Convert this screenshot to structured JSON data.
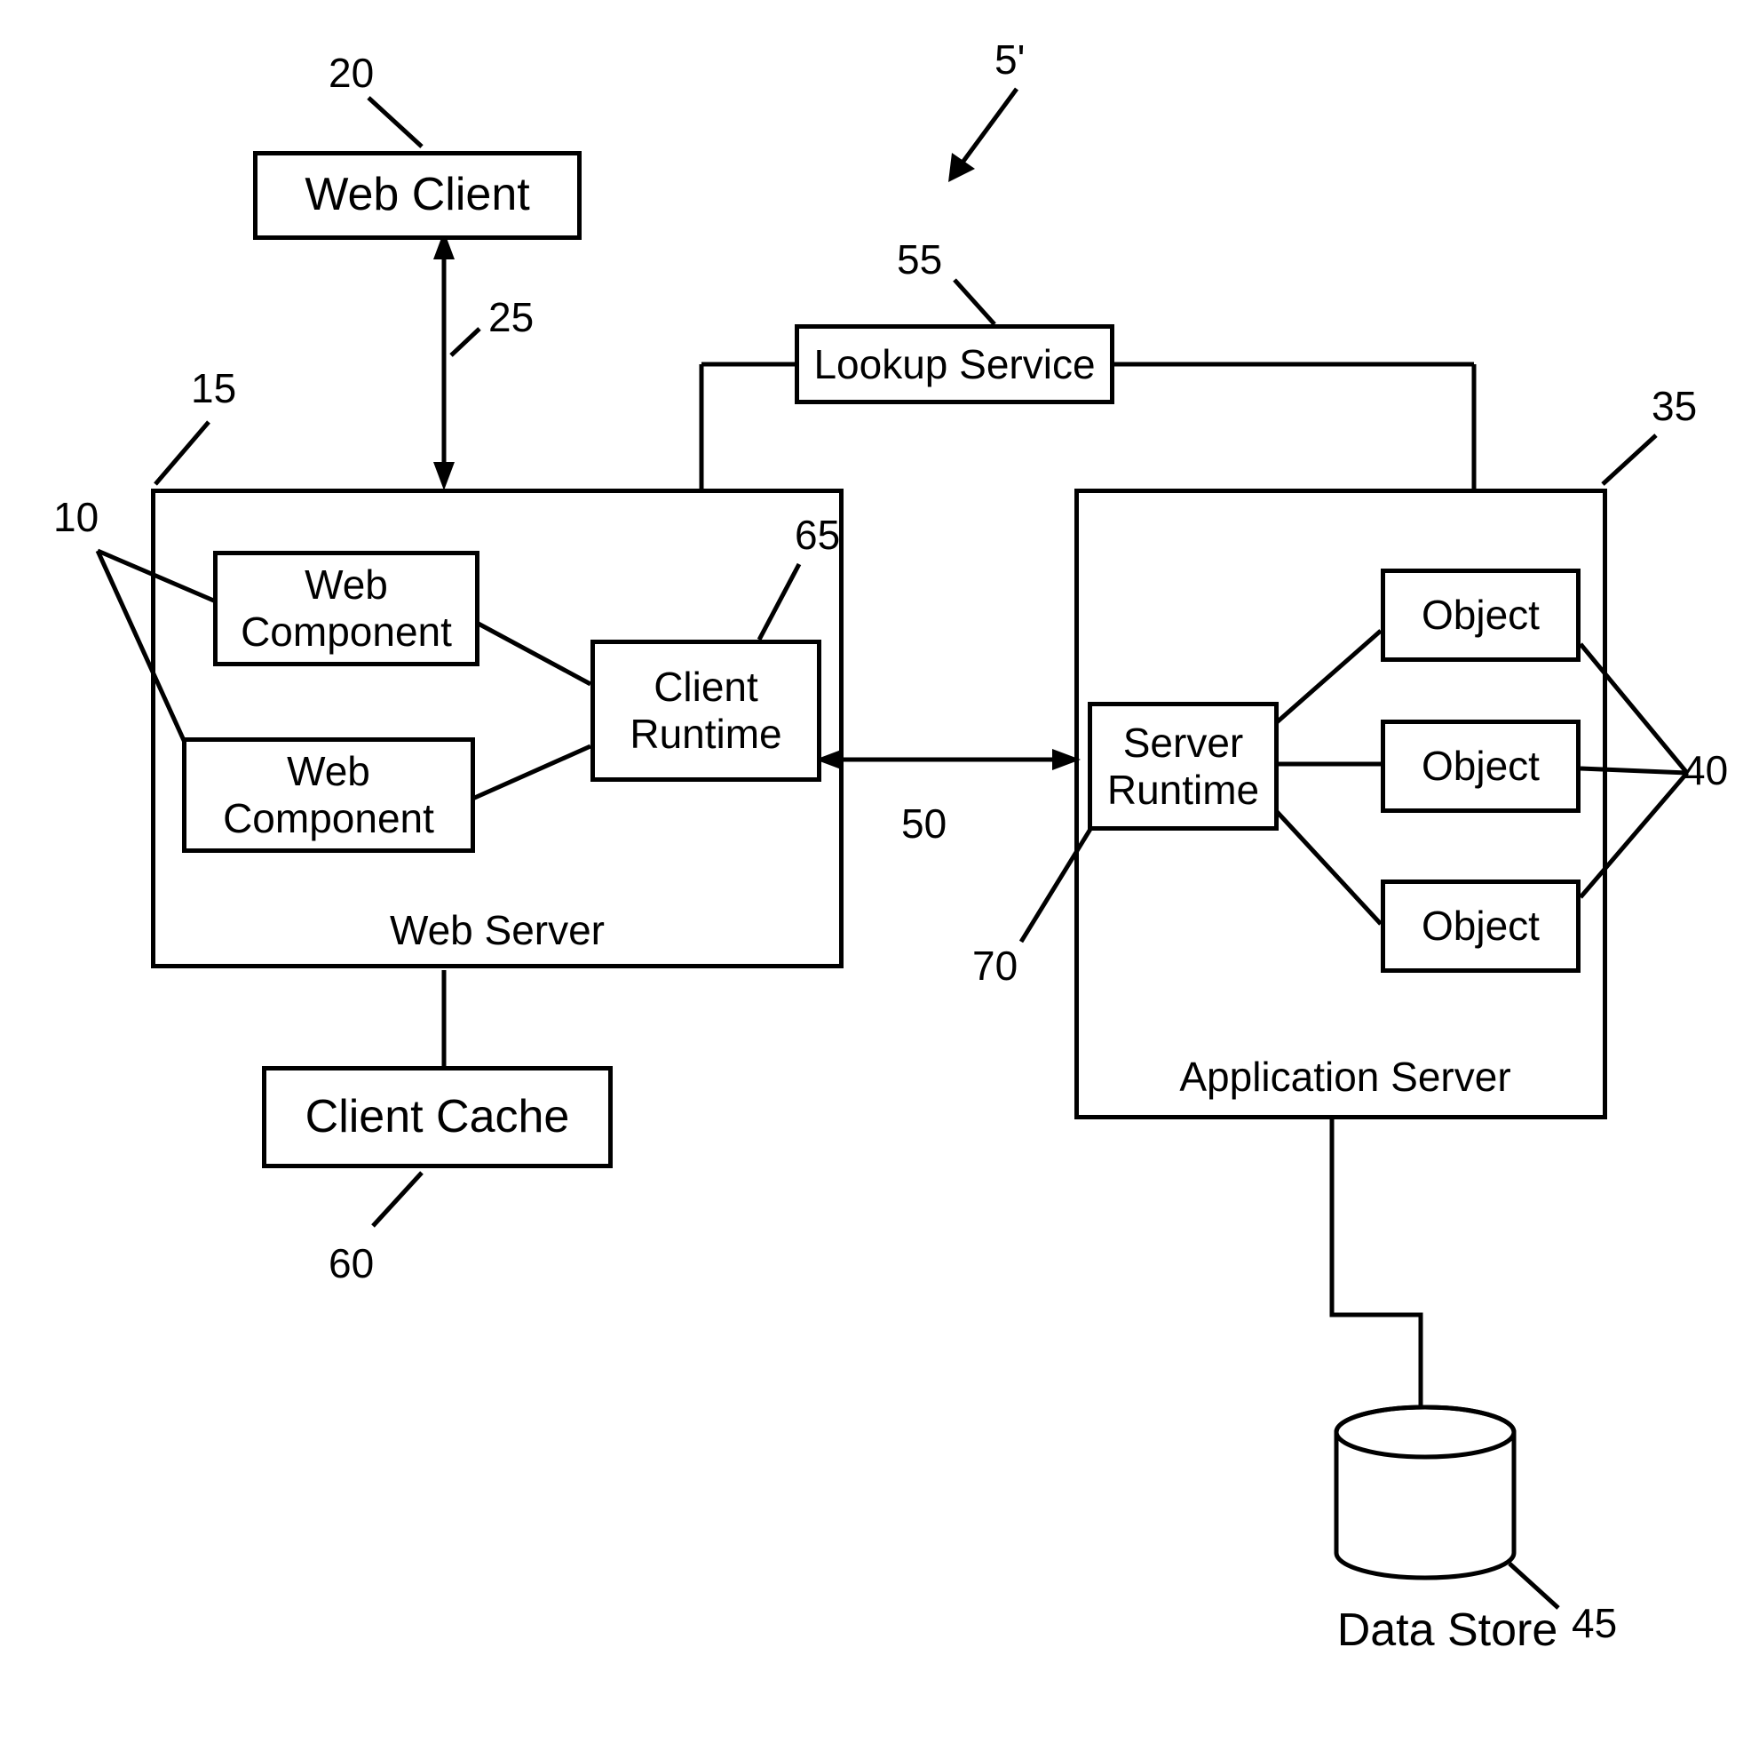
{
  "figure_ref": "5'",
  "boxes": {
    "web_client": "Web Client",
    "lookup_service": "Lookup Service",
    "web_component_1": "Web\nComponent",
    "web_component_2": "Web\nComponent",
    "client_runtime": "Client\nRuntime",
    "server_runtime": "Server\nRuntime",
    "object_1": "Object",
    "object_2": "Object",
    "object_3": "Object",
    "client_cache": "Client Cache"
  },
  "containers": {
    "web_server": "Web Server",
    "app_server": "Application Server"
  },
  "data_store": "Data Store",
  "refs": {
    "r5p": "5'",
    "r10": "10",
    "r15": "15",
    "r20": "20",
    "r25": "25",
    "r35": "35",
    "r40": "40",
    "r45": "45",
    "r50": "50",
    "r55": "55",
    "r60": "60",
    "r65": "65",
    "r70": "70"
  }
}
